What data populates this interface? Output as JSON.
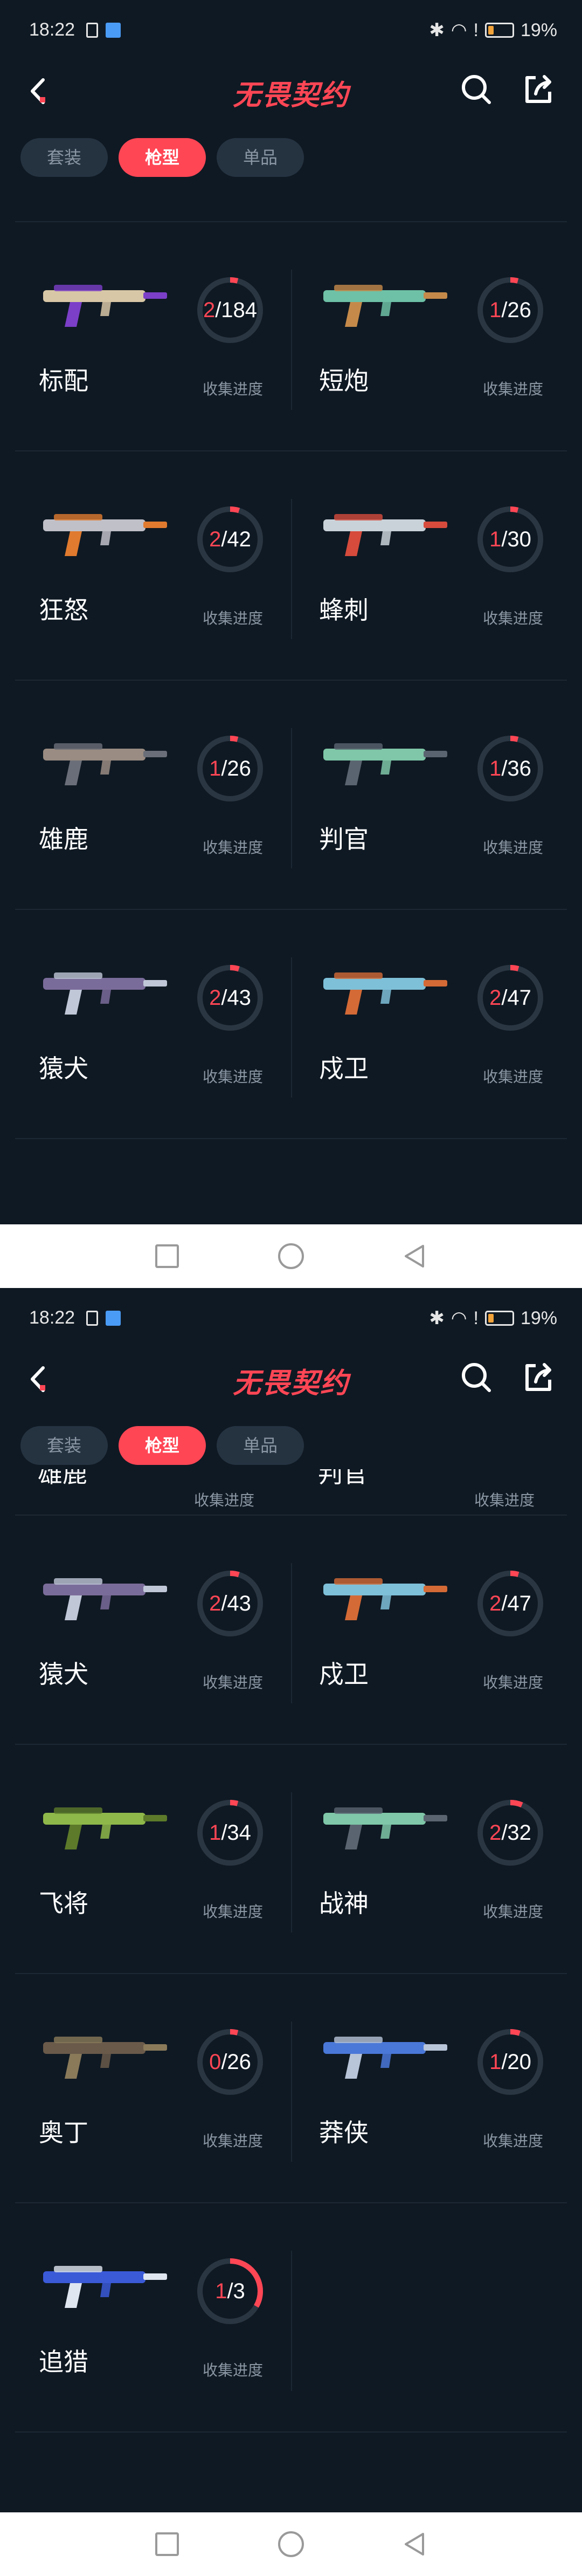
{
  "status_bar": {
    "time": "18:22",
    "battery": "19%"
  },
  "header": {
    "title": "无畏契约"
  },
  "tabs": [
    {
      "label": "套装",
      "active": false
    },
    {
      "label": "枪型",
      "active": true
    },
    {
      "label": "单品",
      "active": false
    }
  ],
  "progress_label": "收集进度",
  "screen1": {
    "weapons": [
      {
        "name": "标配",
        "collected": "2",
        "total": "184",
        "fraction": 0.0109,
        "colors": [
          "#d8c7a6",
          "#7b3fc8"
        ]
      },
      {
        "name": "短炮",
        "collected": "1",
        "total": "26",
        "fraction": 0.038,
        "colors": [
          "#6ec1a6",
          "#c58a4a"
        ]
      },
      {
        "name": "狂怒",
        "collected": "2",
        "total": "42",
        "fraction": 0.048,
        "colors": [
          "#c0c0c8",
          "#e07a2e"
        ]
      },
      {
        "name": "蜂刺",
        "collected": "1",
        "total": "30",
        "fraction": 0.033,
        "colors": [
          "#c9d2d8",
          "#d64b3c"
        ]
      },
      {
        "name": "雄鹿",
        "collected": "1",
        "total": "26",
        "fraction": 0.038,
        "colors": [
          "#9a8c82",
          "#6a6e78"
        ]
      },
      {
        "name": "判官",
        "collected": "1",
        "total": "36",
        "fraction": 0.028,
        "colors": [
          "#7fc7a8",
          "#5a6470"
        ]
      },
      {
        "name": "猿犬",
        "collected": "2",
        "total": "43",
        "fraction": 0.047,
        "colors": [
          "#7a6c9a",
          "#c0c8d8"
        ]
      },
      {
        "name": "戍卫",
        "collected": "2",
        "total": "47",
        "fraction": 0.043,
        "colors": [
          "#7ec0d8",
          "#d46a36"
        ]
      }
    ]
  },
  "screen2": {
    "partial_row": {
      "left": "雄鹿",
      "right": "判官"
    },
    "weapons": [
      {
        "name": "猿犬",
        "collected": "2",
        "total": "43",
        "fraction": 0.047,
        "colors": [
          "#7a6c9a",
          "#c0c8d8"
        ]
      },
      {
        "name": "戍卫",
        "collected": "2",
        "total": "47",
        "fraction": 0.043,
        "colors": [
          "#7ec0d8",
          "#d46a36"
        ]
      },
      {
        "name": "飞将",
        "collected": "1",
        "total": "34",
        "fraction": 0.029,
        "colors": [
          "#8fb84a",
          "#5c7a2a"
        ]
      },
      {
        "name": "战神",
        "collected": "2",
        "total": "32",
        "fraction": 0.063,
        "colors": [
          "#7fc7a8",
          "#5a6470"
        ]
      },
      {
        "name": "奥丁",
        "collected": "0",
        "total": "26",
        "fraction": 0.0,
        "colors": [
          "#6a5a4a",
          "#8a7a5a"
        ]
      },
      {
        "name": "莽侠",
        "collected": "1",
        "total": "20",
        "fraction": 0.05,
        "colors": [
          "#4a78d8",
          "#b8c4d8"
        ]
      },
      {
        "name": "追猎",
        "collected": "1",
        "total": "3",
        "fraction": 0.333,
        "colors": [
          "#3a5ad8",
          "#e0e6f0"
        ]
      }
    ]
  }
}
